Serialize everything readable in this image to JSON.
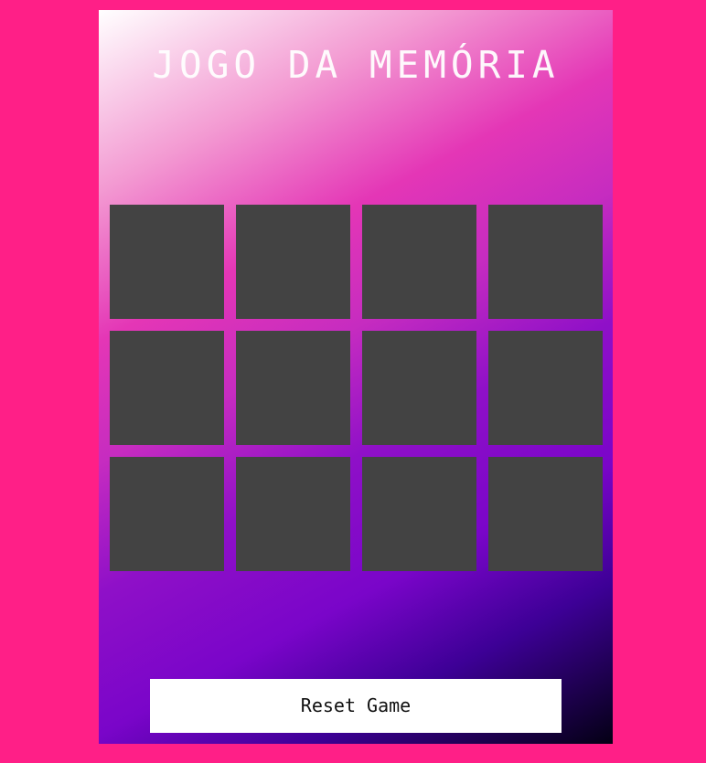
{
  "game": {
    "title": "JOGO DA MEMÓRIA",
    "reset_label": "Reset Game",
    "card_count": 12,
    "card_state": "face-down"
  },
  "colors": {
    "page_background": "#ff1f87",
    "card_back": "#434343",
    "button_background": "#ffffff",
    "title_text": "#ffffff"
  }
}
